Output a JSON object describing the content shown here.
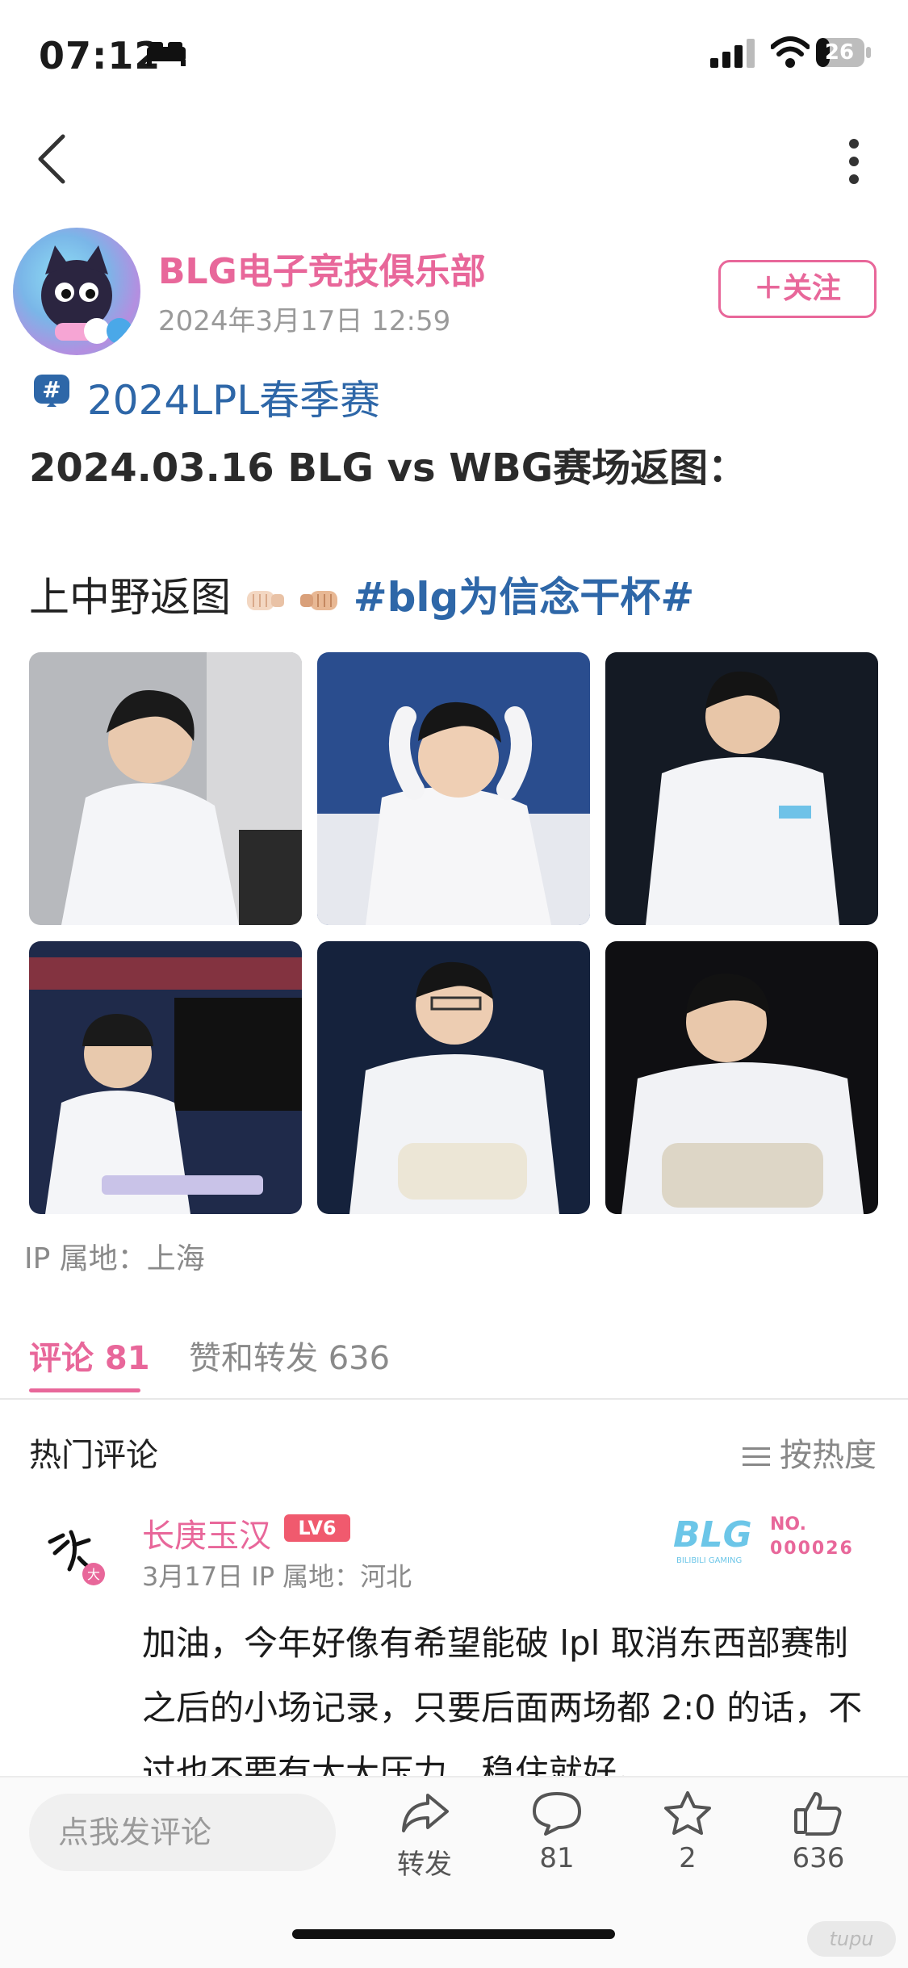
{
  "status_bar": {
    "time": "07:12",
    "battery": "26"
  },
  "post": {
    "author": "BLG电子竞技俱乐部",
    "time": "2024年3月17日 12:59",
    "follow_label": "＋关注",
    "topic": "2024LPL春季赛",
    "title": "2024.03.16 BLG vs WBG赛场返图：",
    "caption_text": "上中野返图",
    "hashtag": "#blg为信念干杯#",
    "ip_location": "IP 属地：上海"
  },
  "tabs": {
    "comments": "评论 81",
    "likes_reposts": "赞和转发 636"
  },
  "comments_section": {
    "title": "热门评论",
    "sort_label": "按热度",
    "comment": {
      "user": "长庚玉汉",
      "level": "LV6",
      "meta": "3月17日  IP 属地：河北",
      "badge_no": "NO.",
      "badge_num": "000026",
      "text": "加油，今年好像有希望能破 lpl 取消东西部赛制之后的小场记录，只要后面两场都 2:0 的话，不过也不要有太大压力，稳住就好。"
    }
  },
  "bottom_bar": {
    "input_placeholder": "点我发评论",
    "repost_label": "转发",
    "comment_count": "81",
    "star_count": "2",
    "like_count": "636"
  },
  "watermark": "tupu",
  "colors": {
    "accent_pink": "#e8679a",
    "topic_blue": "#2e67a8"
  }
}
